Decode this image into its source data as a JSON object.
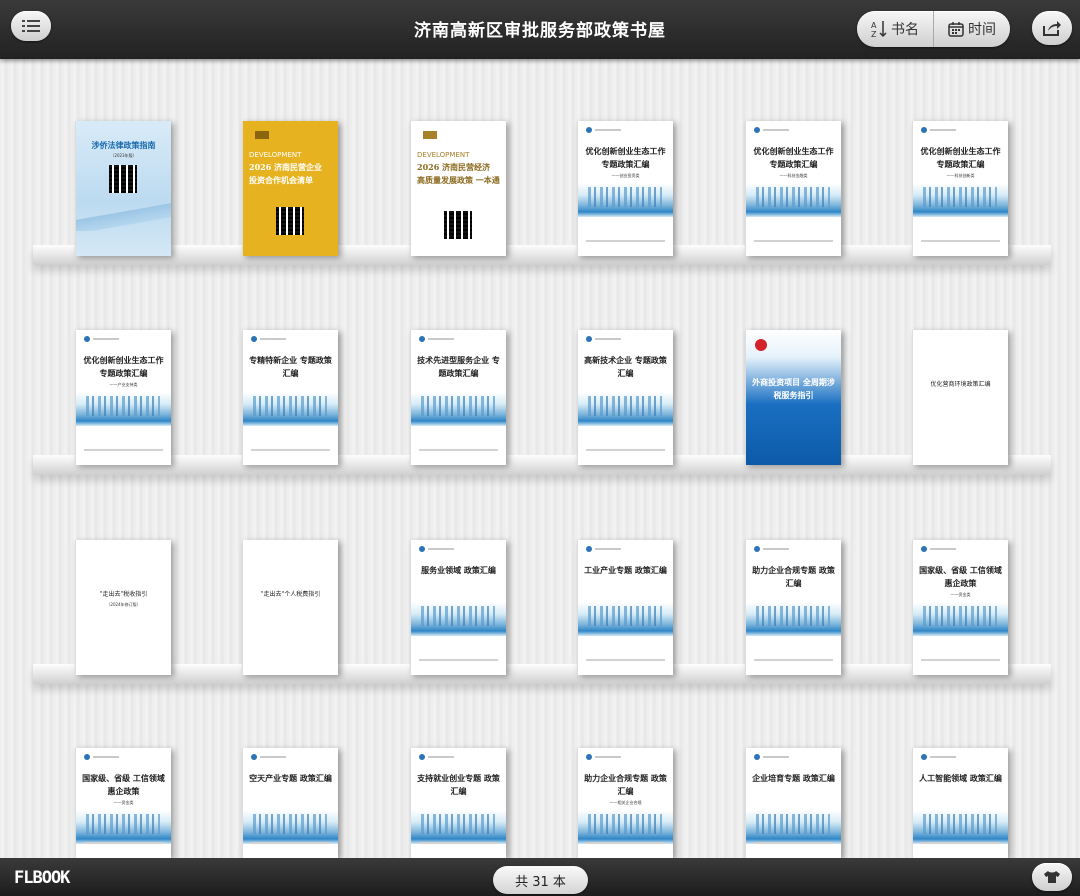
{
  "header": {
    "title": "济南高新区审批服务部政策书屋",
    "sort_by_name": "书名",
    "sort_by_time": "时间"
  },
  "footer": {
    "brand": "FLBOOK",
    "count": "共 31 本"
  },
  "books": [
    {
      "title": "涉侨法律政策指南",
      "subtitle": "（2023年版）",
      "style": "blue-wall"
    },
    {
      "title": "2026 济南民营企业 投资合作机会清单",
      "subtitle": "DEVELOPMENT",
      "style": "yellow"
    },
    {
      "title": "2026 济南民营经济 高质量发展政策 一本通",
      "subtitle": "DEVELOPMENT",
      "style": "white-qr"
    },
    {
      "title": "优化创新创业生态工作 专题政策汇编",
      "subtitle": "——创业投资类",
      "style": "city"
    },
    {
      "title": "优化创新创业生态工作 专题政策汇编",
      "subtitle": "——科技金融类",
      "style": "city"
    },
    {
      "title": "优化创新创业生态工作 专题政策汇编",
      "subtitle": "——科技创新类",
      "style": "city"
    },
    {
      "title": "优化创新创业生态工作 专题政策汇编",
      "subtitle": "——产业支持类",
      "style": "city"
    },
    {
      "title": "专精特新企业 专题政策汇编",
      "subtitle": "",
      "style": "city"
    },
    {
      "title": "技术先进型服务企业 专题政策汇编",
      "subtitle": "",
      "style": "city"
    },
    {
      "title": "高新技术企业 专题政策汇编",
      "subtitle": "",
      "style": "city"
    },
    {
      "title": "外商投资项目 全周期涉税服务指引",
      "subtitle": "",
      "style": "blue"
    },
    {
      "title": "优化营商环境政策汇编",
      "subtitle": "",
      "style": "plain"
    },
    {
      "title": "\"走出去\"税收指引",
      "subtitle": "（2024年修订版）",
      "style": "plain"
    },
    {
      "title": "\"走出去\"个人税费指引",
      "subtitle": "",
      "style": "plain"
    },
    {
      "title": "服务业领域 政策汇编",
      "subtitle": "",
      "style": "city"
    },
    {
      "title": "工业产业专题 政策汇编",
      "subtitle": "",
      "style": "city"
    },
    {
      "title": "助力企业合规专题 政策汇编",
      "subtitle": "",
      "style": "city"
    },
    {
      "title": "国家级、省级 工信领域惠企政策",
      "subtitle": "——资金类",
      "style": "city"
    },
    {
      "title": "国家级、省级 工信领域惠企政策",
      "subtitle": "——资金类",
      "style": "city"
    },
    {
      "title": "空天产业专题 政策汇编",
      "subtitle": "",
      "style": "city"
    },
    {
      "title": "支持就业创业专题 政策汇编",
      "subtitle": "",
      "style": "city"
    },
    {
      "title": "助力企业合规专题 政策汇编",
      "subtitle": "——相关企业合规",
      "style": "city"
    },
    {
      "title": "企业培育专题 政策汇编",
      "subtitle": "",
      "style": "city"
    },
    {
      "title": "人工智能领域 政策汇编",
      "subtitle": "",
      "style": "city"
    }
  ]
}
